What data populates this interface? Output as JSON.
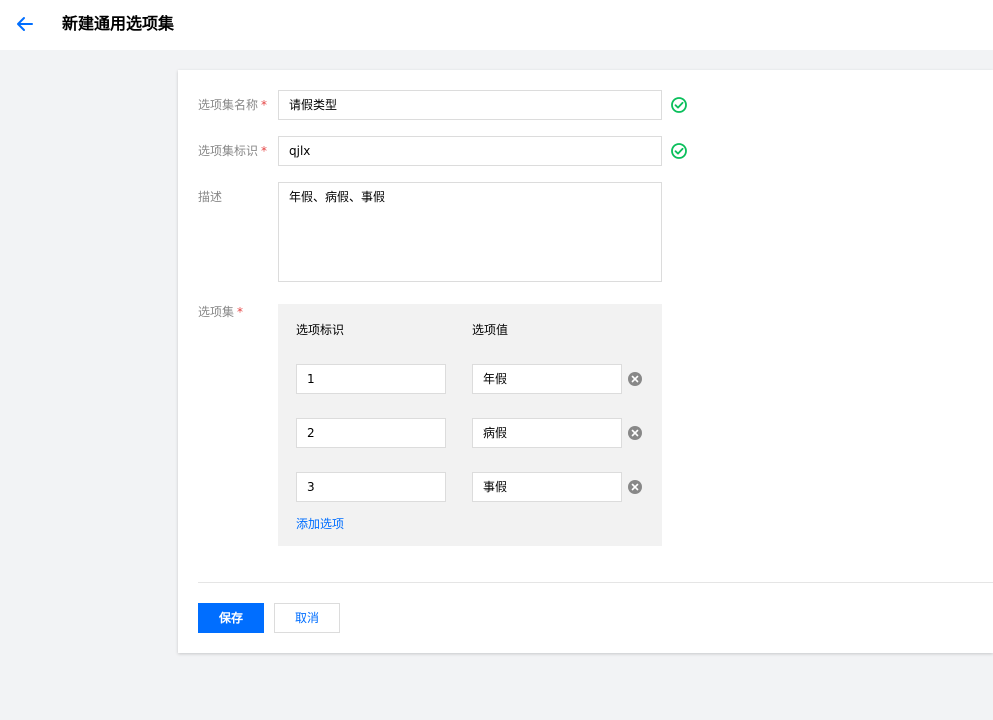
{
  "header": {
    "title": "新建通用选项集",
    "back_icon": "arrow-left-icon"
  },
  "form": {
    "name": {
      "label": "选项集名称",
      "required_mark": "*",
      "value": "请假类型",
      "status_icon": "check-circle-icon"
    },
    "identifier": {
      "label": "选项集标识",
      "required_mark": "*",
      "value": "qjlx",
      "status_icon": "check-circle-icon"
    },
    "description": {
      "label": "描述",
      "value": "年假、病假、事假"
    },
    "options": {
      "label": "选项集",
      "required_mark": "*",
      "col_key_header": "选项标识",
      "col_value_header": "选项值",
      "rows": [
        {
          "key": "1",
          "value": "年假"
        },
        {
          "key": "2",
          "value": "病假"
        },
        {
          "key": "3",
          "value": "事假"
        }
      ],
      "add_label": "添加选项"
    }
  },
  "actions": {
    "save_label": "保存",
    "cancel_label": "取消"
  },
  "colors": {
    "primary": "#006eff",
    "success": "#0abf5b",
    "required": "#e54545",
    "background": "#f2f3f5"
  }
}
